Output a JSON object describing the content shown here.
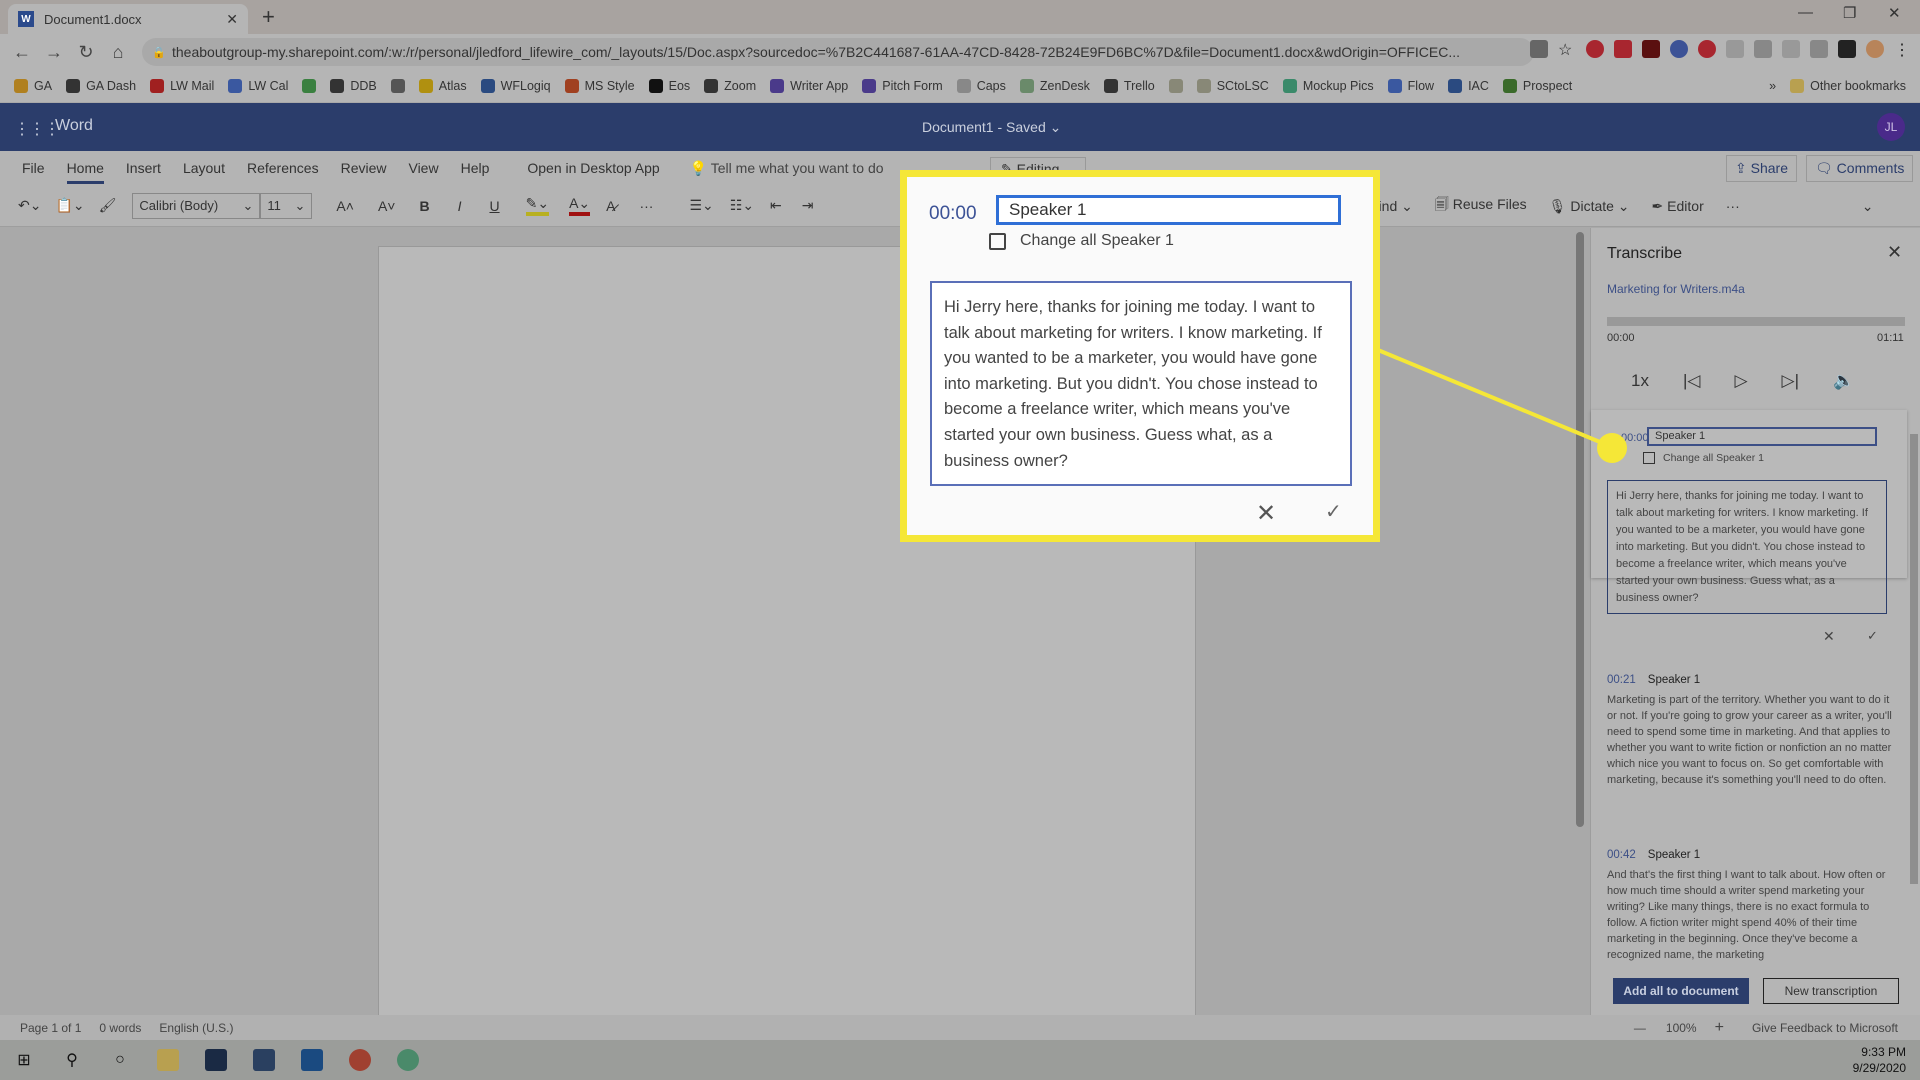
{
  "browser": {
    "tab_title": "Document1.docx",
    "url": "theaboutgroup-my.sharepoint.com/:w:/r/personal/jledford_lifewire_com/_layouts/15/Doc.aspx?sourcedoc=%7B2C441687-61AA-47CD-8428-72B24E9FD6BC%7D&file=Document1.docx&wdOrigin=OFFICEC...",
    "bookmarks": [
      "GA",
      "GA Dash",
      "LW Mail",
      "LW Cal",
      "",
      "DDB",
      "",
      "Atlas",
      "WFLogiq",
      "MS Style",
      "Eos",
      "Zoom",
      "Writer App",
      "Pitch Form",
      "Caps",
      "ZenDesk",
      "Trello",
      "",
      "SCtoLSC",
      "Mockup Pics",
      "Flow",
      "IAC",
      "Prospect"
    ],
    "other_bookmarks": "Other bookmarks",
    "overflow": "»"
  },
  "word": {
    "app_name": "Word",
    "doc_title": "Document1  -  Saved ⌄",
    "avatar": "JL",
    "ribbon_tabs": [
      "File",
      "Home",
      "Insert",
      "Layout",
      "References",
      "Review",
      "View",
      "Help",
      "Open in Desktop App"
    ],
    "tell_me": "Tell me what you want to do",
    "editing": "✎ Editing ⌄",
    "share": "Share",
    "comments": "Comments",
    "font": "Calibri (Body)",
    "size": "11",
    "find": "Find ⌄",
    "reuse_files": "Reuse Files",
    "dictate": "Dictate ⌄",
    "editor": "Editor"
  },
  "panel": {
    "title": "Transcribe",
    "file": "Marketing for Writers.m4a",
    "time_start": "00:00",
    "time_end": "01:11",
    "progress": 0,
    "speed": "1x",
    "edit": {
      "time": "00:00",
      "speaker": "Speaker 1",
      "change_all": "Change all Speaker 1",
      "text": "Hi Jerry here, thanks for joining me today. I want to talk about marketing for writers. I know marketing. If you wanted to be a marketer, you would have gone into marketing. But you didn't. You chose instead to become a freelance writer, which means you've started your own business. Guess what, as a business owner?"
    },
    "segments": [
      {
        "time": "00:21",
        "speaker": "Speaker 1",
        "text": "Marketing is part of the territory. Whether you want to do it or not. If you're going to grow your career as a writer, you'll need to spend some time in marketing. And that applies to whether you want to write fiction or nonfiction an no matter which nice you want to focus on. So get comfortable with marketing, because it's something you'll need to do often."
      },
      {
        "time": "00:42",
        "speaker": "Speaker 1",
        "text": "And that's the first thing I want to talk about. How often or how much time should a writer spend marketing your writing? Like many things, there is no exact formula to follow. A fiction writer might spend 40% of their time marketing in the beginning. Once they've become a recognized name, the marketing"
      }
    ],
    "add_all": "Add all to document",
    "new_transcription": "New transcription"
  },
  "status": {
    "page": "Page 1 of 1",
    "words": "0 words",
    "language": "English (U.S.)",
    "zoom": "100%",
    "feedback": "Give Feedback to Microsoft"
  },
  "taskbar": {
    "time": "9:33 PM",
    "date": "9/29/2020"
  },
  "colors": {
    "word_blue": "#2b3d6b",
    "callout_yellow": "#f5e737",
    "time_blue": "#3c5296"
  }
}
